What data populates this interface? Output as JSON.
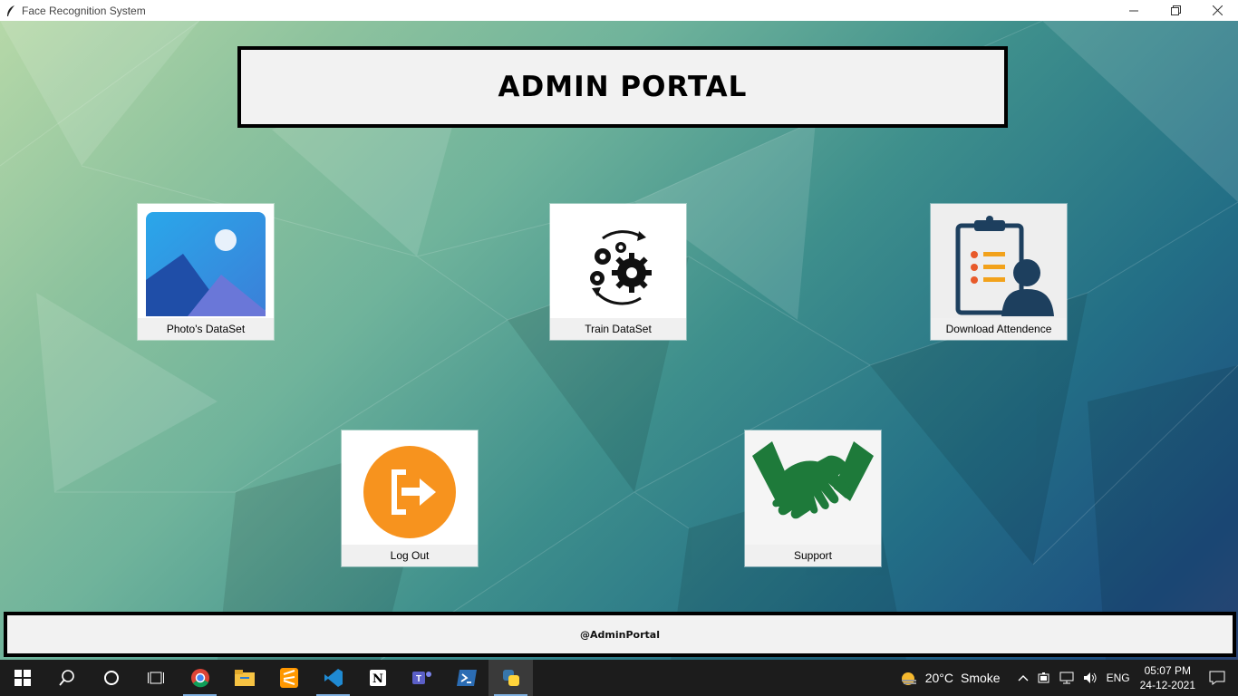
{
  "window": {
    "title": "Face Recognition System"
  },
  "header": {
    "title": "ADMIN PORTAL"
  },
  "tiles": [
    {
      "label": "Photo's DataSet"
    },
    {
      "label": "Train DataSet"
    },
    {
      "label": "Download Attendence"
    },
    {
      "label": "Log Out"
    },
    {
      "label": "Support"
    }
  ],
  "footer": {
    "text": "@AdminPortal"
  },
  "taskbar": {
    "weather_temp": "20°C",
    "weather_text": "Smoke",
    "lang": "ENG",
    "time": "05:07 PM",
    "date": "24-12-2021"
  },
  "colors": {
    "logout_orange": "#f7931e",
    "support_green": "#1e7a3a",
    "photo_blue": "#2f8fe0"
  }
}
